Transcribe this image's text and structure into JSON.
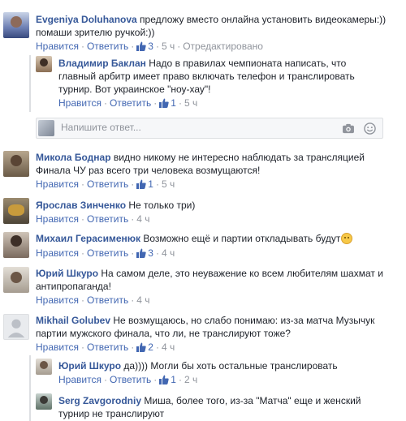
{
  "labels": {
    "like": "Нравится",
    "reply": "Ответить",
    "edited": "Отредактировано",
    "dot": "·"
  },
  "reply_box": {
    "placeholder": "Напишите ответ..."
  },
  "comments": [
    {
      "author": "Evgeniya Doluhanova",
      "lines": [
        "предложу вместо онлайна установить видеокамеры:))",
        "помаши зрителю ручкой:))"
      ],
      "likes": "3",
      "time": "5 ч",
      "edited": true,
      "replies": [
        {
          "author": "Владимир Баклан",
          "lines": [
            "Надо в правилах чемпионата написать, что",
            "главный арбитр имеет право включать телефон и транслировать",
            "турнир. Вот украинское \"ноу-хау\"!"
          ],
          "likes": "1",
          "time": "5 ч"
        }
      ]
    },
    {
      "author": "Микола Боднар",
      "lines": [
        "видно никому не интересно наблюдать за трансляцией",
        "Финала ЧУ раз всего три человека возмущаются!"
      ],
      "likes": "1",
      "time": "5 ч"
    },
    {
      "author": "Ярослав Зинченко",
      "lines": [
        "Не только три)"
      ],
      "likes": "",
      "time": "4 ч"
    },
    {
      "author": "Михаил Герасименюк",
      "lines": [
        "Возможно ещё и партии откладывать будут"
      ],
      "likes": "3",
      "time": "4 ч"
    },
    {
      "author": "Юрий Шкуро",
      "lines": [
        "На самом деле, это неуважение ко всем любителям шахмат и",
        "антипропаганда!"
      ],
      "likes": "",
      "time": "4 ч"
    },
    {
      "author": "Mikhail Golubev",
      "lines": [
        "Не возмущаюсь, но слабо понимаю: из-за матча Музычук",
        "партии мужского финала, что ли, не транслируют тоже?"
      ],
      "likes": "2",
      "time": "4 ч",
      "replies": [
        {
          "author": "Юрий Шкуро",
          "lines": [
            "да)))) Могли бы хоть остальные транслировать"
          ],
          "likes": "1",
          "time": "2 ч"
        },
        {
          "author": "Serg Zavgorodniy",
          "lines": [
            "Миша, более того, из-за \"Матча\" еще и женский",
            "турнир не транслируют"
          ],
          "likes": "",
          "time": ""
        }
      ]
    }
  ],
  "icons": {
    "like": "thumbs-up-icon",
    "camera": "camera-icon",
    "emoji": "smiley-icon"
  },
  "colors": {
    "link": "#365899",
    "action": "#4267b2",
    "meta": "#90949c",
    "text": "#1d2129"
  }
}
